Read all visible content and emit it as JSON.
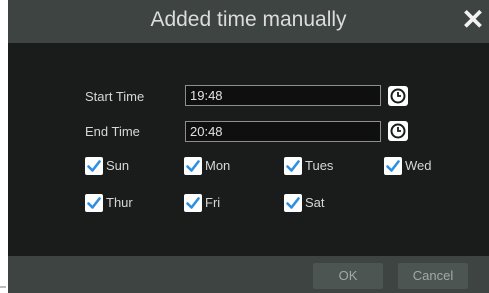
{
  "dialog": {
    "title": "Added time manually",
    "close_symbol": "✕"
  },
  "fields": {
    "start_label": "Start Time",
    "start_value": "19:48",
    "end_label": "End Time",
    "end_value": "20:48",
    "clock_icon": "clock-icon"
  },
  "days": [
    {
      "label": "Sun",
      "checked": true
    },
    {
      "label": "Mon",
      "checked": true
    },
    {
      "label": "Tues",
      "checked": true
    },
    {
      "label": "Wed",
      "checked": true
    },
    {
      "label": "Thur",
      "checked": true
    },
    {
      "label": "Fri",
      "checked": true
    },
    {
      "label": "Sat",
      "checked": true
    }
  ],
  "footer": {
    "ok_label": "OK",
    "cancel_label": "Cancel"
  },
  "colors": {
    "checkbox_mark": "#2f8fe0",
    "dialog_bg": "#1a1c1b",
    "titlebar_bg": "#3d4442"
  }
}
